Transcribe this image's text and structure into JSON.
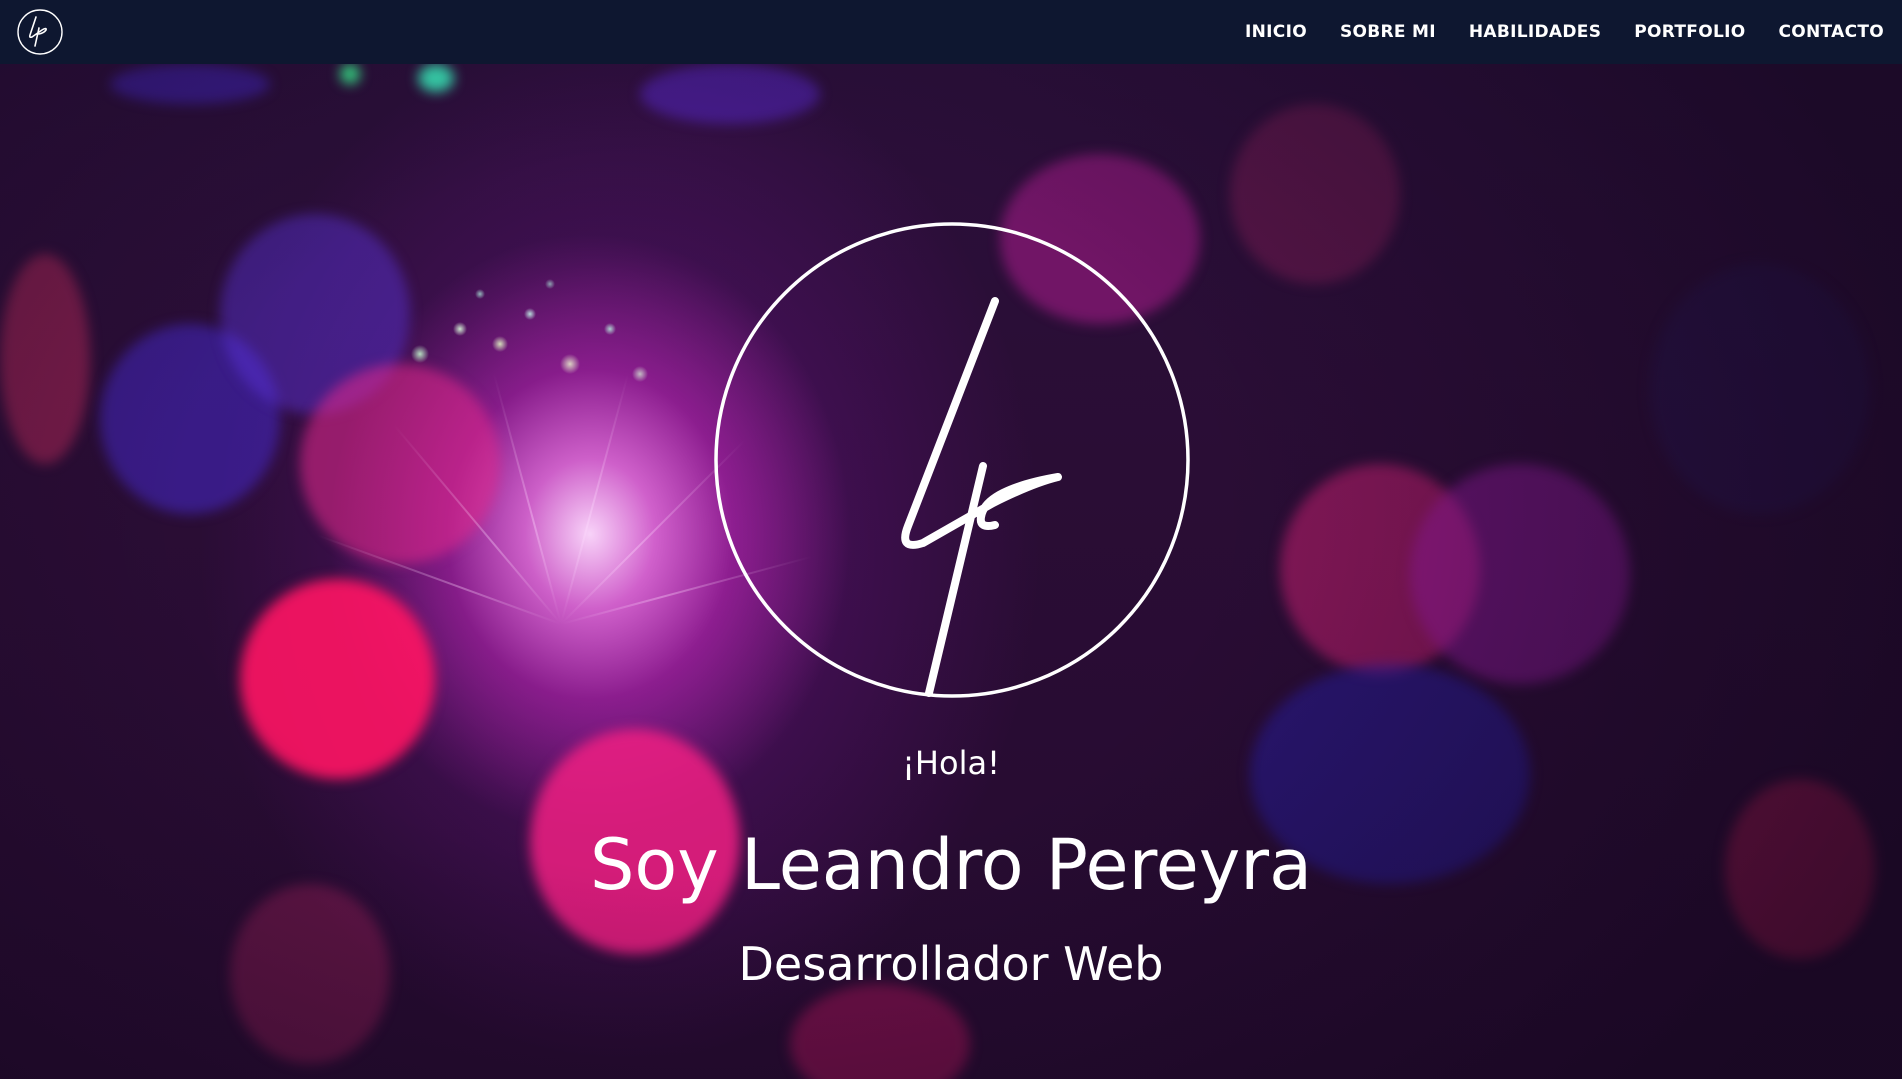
{
  "navbar": {
    "logo_icon": "lp-signature-logo-icon",
    "items": [
      {
        "label": "INICIO"
      },
      {
        "label": "SOBRE MI"
      },
      {
        "label": "HABILIDADES"
      },
      {
        "label": "PORTFOLIO"
      },
      {
        "label": "CONTACTO"
      }
    ],
    "background_color": "#0e1730"
  },
  "hero": {
    "logo_icon": "lp-signature-logo-icon",
    "greeting": "¡Hola!",
    "name": "Soy Leandro Pereyra",
    "role": "Desarrollador Web",
    "text_color": "#ffffff",
    "accent_colors": [
      "#ff1e78",
      "#c82ac8",
      "#3b2fd0",
      "#8a1f6a"
    ]
  }
}
